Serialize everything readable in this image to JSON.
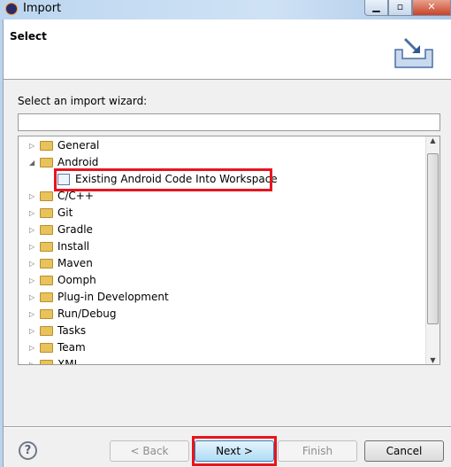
{
  "window": {
    "title": "Import",
    "controls": [
      "minimize",
      "maximize",
      "close"
    ]
  },
  "header": {
    "title": "Select",
    "icon": "import-wizard-icon"
  },
  "wizard": {
    "label": "Select an import wizard:",
    "filter_value": "",
    "tree": [
      {
        "label": "General",
        "expanded": false,
        "level": 0
      },
      {
        "label": "Android",
        "expanded": true,
        "level": 0
      },
      {
        "label": "Existing Android Code Into Workspace",
        "level": 1,
        "highlighted": true
      },
      {
        "label": "C/C++",
        "expanded": false,
        "level": 0
      },
      {
        "label": "Git",
        "expanded": false,
        "level": 0
      },
      {
        "label": "Gradle",
        "expanded": false,
        "level": 0
      },
      {
        "label": "Install",
        "expanded": false,
        "level": 0
      },
      {
        "label": "Maven",
        "expanded": false,
        "level": 0
      },
      {
        "label": "Oomph",
        "expanded": false,
        "level": 0
      },
      {
        "label": "Plug-in Development",
        "expanded": false,
        "level": 0
      },
      {
        "label": "Run/Debug",
        "expanded": false,
        "level": 0
      },
      {
        "label": "Tasks",
        "expanded": false,
        "level": 0
      },
      {
        "label": "Team",
        "expanded": false,
        "level": 0
      },
      {
        "label": "XML",
        "expanded": false,
        "level": 0
      }
    ]
  },
  "buttons": {
    "back": "< Back",
    "next": "Next >",
    "finish": "Finish",
    "cancel": "Cancel",
    "help": "?"
  },
  "colors": {
    "highlight": "#e8141e"
  }
}
